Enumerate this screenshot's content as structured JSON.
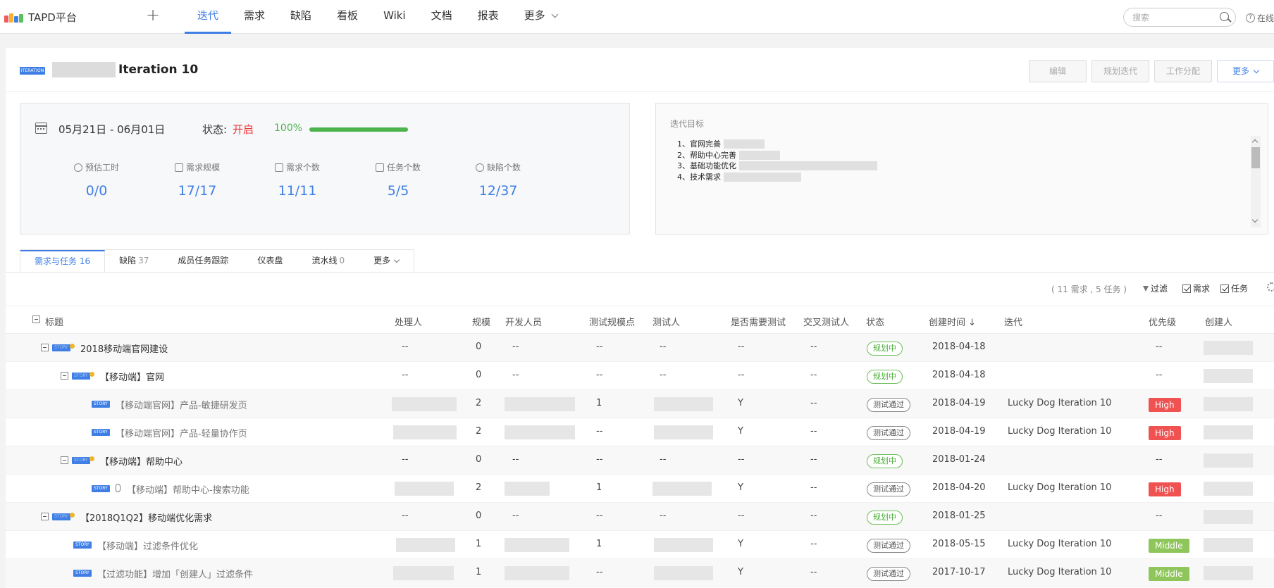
{
  "topbar": {
    "logo_text": "TAPD平台",
    "nav": [
      {
        "label": "迭代",
        "active": true
      },
      {
        "label": "需求"
      },
      {
        "label": "缺陷"
      },
      {
        "label": "看板"
      },
      {
        "label": "Wiki"
      },
      {
        "label": "文档"
      },
      {
        "label": "报表"
      },
      {
        "label": "更多"
      }
    ],
    "search_placeholder": "搜索",
    "help_label": "在线"
  },
  "iteration": {
    "badge": "ITERATION",
    "title": "Iteration 10",
    "actions": {
      "edit": "编辑",
      "plan": "规划迭代",
      "assign": "工作分配",
      "more": "更多"
    }
  },
  "stats": {
    "date_range": "05月21日  -  06月01日",
    "status_label": "状态:",
    "status_value": "开启",
    "progress_pct": "100%",
    "progress_value": 100,
    "items": [
      {
        "label": "预估工时",
        "value": "0/0"
      },
      {
        "label": "需求规模",
        "value": "17/17"
      },
      {
        "label": "需求个数",
        "value": "11/11"
      },
      {
        "label": "任务个数",
        "value": "5/5"
      },
      {
        "label": "缺陷个数",
        "value": "12/37"
      }
    ]
  },
  "goal": {
    "title": "迭代目标",
    "items": [
      "1、官网完善",
      "2、帮助中心完善",
      "3、基础功能优化",
      "4、技术需求"
    ]
  },
  "tabs": [
    {
      "label": "需求与任务",
      "count": "16",
      "active": true
    },
    {
      "label": "缺陷",
      "count": "37"
    },
    {
      "label": "成员任务跟踪",
      "count": ""
    },
    {
      "label": "仪表盘",
      "count": ""
    },
    {
      "label": "流水线",
      "count": "0"
    },
    {
      "label": "更多",
      "count": ""
    }
  ],
  "toolbar": {
    "summary": "( 11 需求 , 5 任务 )",
    "filter": "过滤",
    "show_stories": "需求",
    "show_tasks": "任务"
  },
  "table": {
    "headers": {
      "title": "标题",
      "owner": "处理人",
      "size": "规模",
      "developer": "开发人员",
      "test_points": "测试规模点",
      "tester": "测试人",
      "need_test": "是否需要测试",
      "cross_tester": "交叉测试人",
      "status": "状态",
      "created": "创建时间 ↓",
      "iteration": "迭代",
      "priority": "优先级",
      "creator": "创建人"
    },
    "story_tag": "STORY",
    "rows": [
      {
        "title": "2018移动端官网建设",
        "owner": "--",
        "size": "0",
        "developer": "--",
        "test_points": "--",
        "tester": "--",
        "need_test": "--",
        "cross": "--",
        "status": "规划中",
        "created": "2018-04-18",
        "iteration": "",
        "priority": "--"
      },
      {
        "title": "【移动端】官网",
        "owner": "--",
        "size": "0",
        "developer": "--",
        "test_points": "--",
        "tester": "--",
        "need_test": "--",
        "cross": "--",
        "status": "规划中",
        "created": "2018-04-18",
        "iteration": "",
        "priority": "--"
      },
      {
        "title": "【移动端官网】产品-敏捷研发页",
        "owner": "",
        "size": "2",
        "developer": "",
        "test_points": "1",
        "tester": "",
        "need_test": "Y",
        "cross": "--",
        "status": "测试通过",
        "created": "2018-04-19",
        "iteration": "Lucky Dog Iteration 10",
        "priority": "High"
      },
      {
        "title": "【移动端官网】产品-轻量协作页",
        "owner": "",
        "size": "2",
        "developer": "",
        "test_points": "--",
        "tester": "",
        "need_test": "Y",
        "cross": "--",
        "status": "测试通过",
        "created": "2018-04-19",
        "iteration": "Lucky Dog Iteration 10",
        "priority": "High"
      },
      {
        "title": "【移动端】帮助中心",
        "owner": "--",
        "size": "0",
        "developer": "--",
        "test_points": "--",
        "tester": "--",
        "need_test": "--",
        "cross": "--",
        "status": "规划中",
        "created": "2018-01-24",
        "iteration": "",
        "priority": "--"
      },
      {
        "title": "【移动端】帮助中心-搜索功能",
        "owner": "",
        "size": "2",
        "developer": "",
        "test_points": "1",
        "tester": "",
        "need_test": "Y",
        "cross": "--",
        "status": "测试通过",
        "created": "2018-04-20",
        "iteration": "Lucky Dog Iteration 10",
        "priority": "High"
      },
      {
        "title": "【2018Q1Q2】移动端优化需求",
        "owner": "--",
        "size": "0",
        "developer": "--",
        "test_points": "--",
        "tester": "--",
        "need_test": "--",
        "cross": "--",
        "status": "规划中",
        "created": "2018-01-25",
        "iteration": "",
        "priority": "--"
      },
      {
        "title": "【移动端】过滤条件优化",
        "owner": "",
        "size": "1",
        "developer": "",
        "test_points": "1",
        "tester": "",
        "need_test": "Y",
        "cross": "--",
        "status": "测试通过",
        "created": "2018-05-15",
        "iteration": "Lucky Dog Iteration 10",
        "priority": "Middle"
      },
      {
        "title": "【过滤功能】增加「创建人」过滤条件",
        "owner": "",
        "size": "1",
        "developer": "",
        "test_points": "--",
        "tester": "",
        "need_test": "Y",
        "cross": "--",
        "status": "测试通过",
        "created": "2017-10-17",
        "iteration": "Lucky Dog Iteration 10",
        "priority": "Middle"
      }
    ]
  }
}
